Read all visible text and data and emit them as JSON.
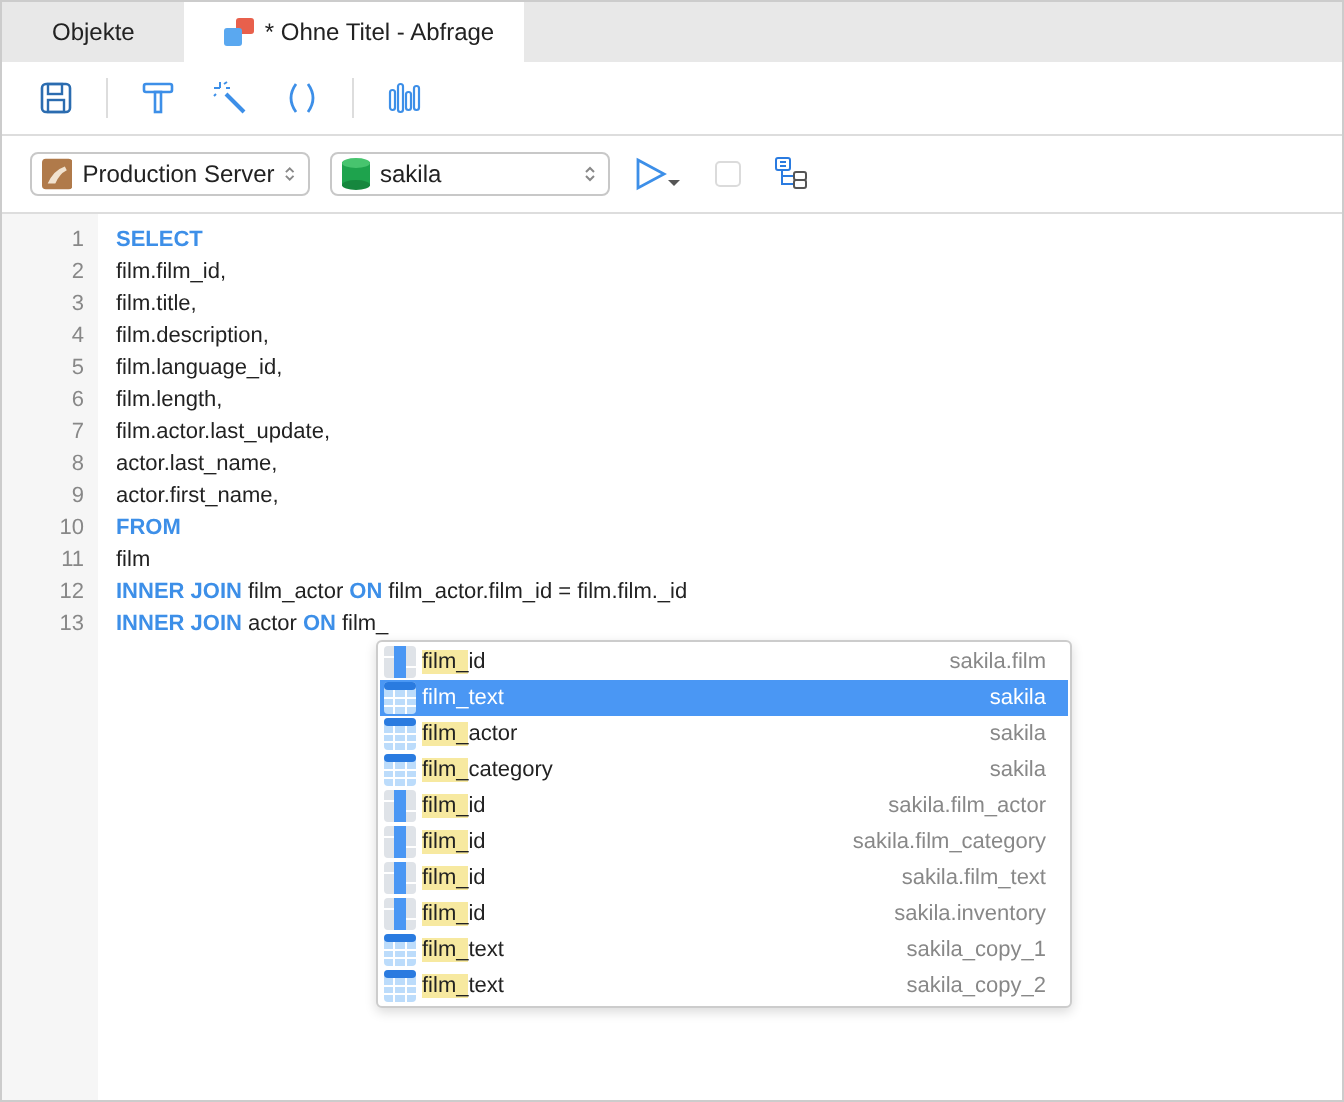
{
  "tabs": [
    {
      "label": "Objekte",
      "selected": false,
      "kind": "plain"
    },
    {
      "label": "* Ohne Titel - Abfrage",
      "selected": true,
      "kind": "query"
    }
  ],
  "toolbar": {
    "buttons": [
      {
        "kind": "save"
      },
      {
        "kind": "divider"
      },
      {
        "kind": "format"
      },
      {
        "kind": "magic"
      },
      {
        "kind": "parens"
      },
      {
        "kind": "divider"
      },
      {
        "kind": "explain"
      }
    ]
  },
  "connection": {
    "server": "Production Server",
    "database": "sakila",
    "run_enabled": true,
    "stop_enabled": false
  },
  "editor": {
    "lines": [
      {
        "number": "1",
        "tokens": [
          {
            "kind": "keyword",
            "text": "SELECT"
          }
        ]
      },
      {
        "number": "2",
        "tokens": [
          {
            "kind": "plain",
            "text": "film.film_id,"
          }
        ]
      },
      {
        "number": "3",
        "tokens": [
          {
            "kind": "plain",
            "text": "film.title,"
          }
        ]
      },
      {
        "number": "4",
        "tokens": [
          {
            "kind": "plain",
            "text": "film.description,"
          }
        ]
      },
      {
        "number": "5",
        "tokens": [
          {
            "kind": "plain",
            "text": "film.language_id,"
          }
        ]
      },
      {
        "number": "6",
        "tokens": [
          {
            "kind": "plain",
            "text": "film.length,"
          }
        ]
      },
      {
        "number": "7",
        "tokens": [
          {
            "kind": "plain",
            "text": "film.actor.last_update,"
          }
        ]
      },
      {
        "number": "8",
        "tokens": [
          {
            "kind": "plain",
            "text": "actor.last_name,"
          }
        ]
      },
      {
        "number": "9",
        "tokens": [
          {
            "kind": "plain",
            "text": "actor.first_name,"
          }
        ]
      },
      {
        "number": "10",
        "tokens": [
          {
            "kind": "keyword",
            "text": "FROM"
          }
        ]
      },
      {
        "number": "11",
        "tokens": [
          {
            "kind": "plain",
            "text": "film"
          }
        ]
      },
      {
        "number": "12",
        "tokens": [
          {
            "kind": "keyword",
            "text": "INNER JOIN"
          },
          {
            "kind": "plain",
            "text": "film_actor"
          },
          {
            "kind": "keyword",
            "text": "ON"
          },
          {
            "kind": "plain",
            "text": "film_actor.film_id = film.film._id"
          }
        ]
      },
      {
        "number": "13",
        "tokens": [
          {
            "kind": "keyword",
            "text": "INNER JOIN"
          },
          {
            "kind": "plain",
            "text": "actor"
          },
          {
            "kind": "keyword",
            "text": "ON"
          },
          {
            "kind": "plain",
            "text": "film_"
          }
        ]
      }
    ]
  },
  "autocomplete": {
    "items": [
      {
        "kind": "column",
        "match": "film_",
        "rest": "id",
        "source": "sakila.film",
        "selected": false
      },
      {
        "kind": "table",
        "match": "film_",
        "rest": "text",
        "source": "sakila",
        "selected": true
      },
      {
        "kind": "table",
        "match": "film_",
        "rest": "actor",
        "source": "sakila",
        "selected": false
      },
      {
        "kind": "table",
        "match": "film_",
        "rest": "category",
        "source": "sakila",
        "selected": false
      },
      {
        "kind": "column",
        "match": "film_",
        "rest": "id",
        "source": "sakila.film_actor",
        "selected": false
      },
      {
        "kind": "column",
        "match": "film_",
        "rest": "id",
        "source": "sakila.film_category",
        "selected": false
      },
      {
        "kind": "column",
        "match": "film_",
        "rest": "id",
        "source": "sakila.film_text",
        "selected": false
      },
      {
        "kind": "column",
        "match": "film_",
        "rest": "id",
        "source": "sakila.inventory",
        "selected": false
      },
      {
        "kind": "table",
        "match": "film_",
        "rest": "text",
        "source": "sakila_copy_1",
        "selected": false
      },
      {
        "kind": "table",
        "match": "film_",
        "rest": "text",
        "source": "sakila_copy_2",
        "selected": false
      }
    ]
  }
}
